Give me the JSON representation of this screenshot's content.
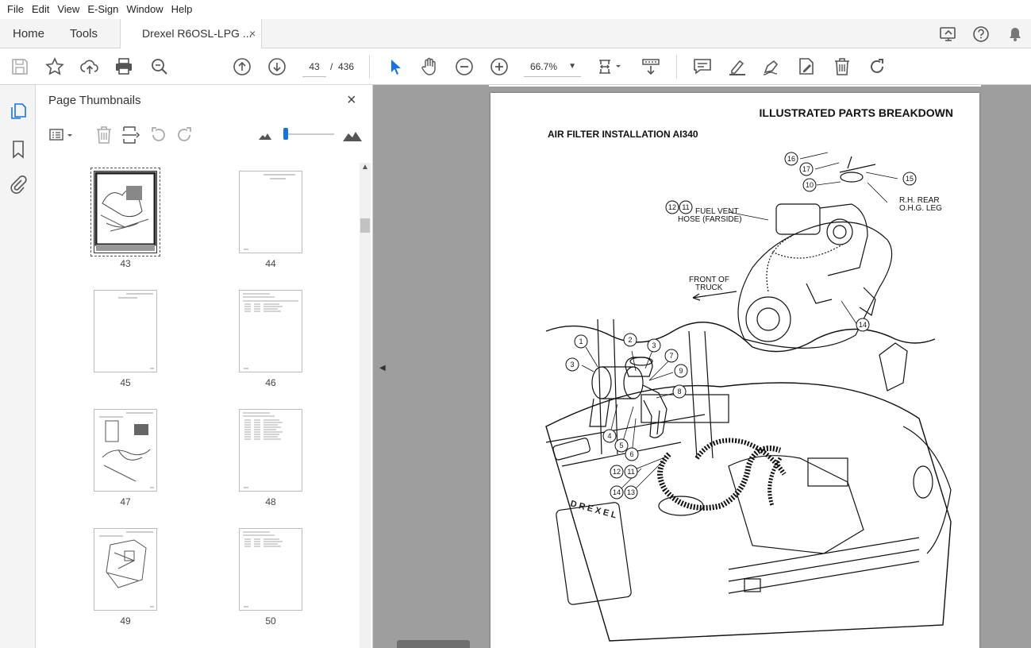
{
  "menu": [
    "File",
    "Edit",
    "View",
    "E-Sign",
    "Window",
    "Help"
  ],
  "tabs": {
    "home": "Home",
    "tools": "Tools",
    "document": "Drexel R6OSL-LPG ...",
    "close": "×"
  },
  "toolbar": {
    "page_current": "43",
    "page_separator": "/",
    "page_total": "436",
    "zoom": "66.7%"
  },
  "panel": {
    "title": "Page Thumbnails",
    "close": "×",
    "thumbnails": [
      {
        "page": "43",
        "selected": true
      },
      {
        "page": "44"
      },
      {
        "page": "45"
      },
      {
        "page": "46"
      },
      {
        "page": "47"
      },
      {
        "page": "48"
      },
      {
        "page": "49"
      },
      {
        "page": "50"
      }
    ]
  },
  "document": {
    "header": "ILLUSTRATED PARTS BREAKDOWN",
    "subtitle": "AIR FILTER INSTALLATION AI340",
    "labels": {
      "fuel_vent_1": "FUEL VENT",
      "fuel_vent_2": "HOSE (FARSIDE)",
      "rh_rear_1": "R.H. REAR",
      "rh_rear_2": "O.H.G. LEG",
      "front_1": "FRONT OF",
      "front_2": "TRUCK",
      "brand": "DREXEL"
    },
    "callouts": [
      "16",
      "17",
      "10",
      "15",
      "12",
      "11",
      "14",
      "1",
      "2",
      "3",
      "3",
      "7",
      "9",
      "8",
      "4",
      "5",
      "6",
      "12",
      "11",
      "14",
      "13"
    ]
  },
  "colors": {
    "accent": "#1473e6",
    "doc_bg": "#9e9e9e"
  }
}
